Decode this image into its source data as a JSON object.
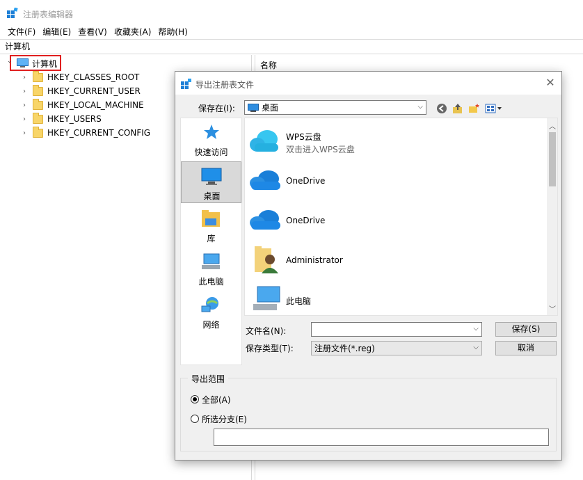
{
  "app": {
    "title": "注册表编辑器",
    "menu": [
      "文件(F)",
      "编辑(E)",
      "查看(V)",
      "收藏夹(A)",
      "帮助(H)"
    ],
    "address": "计算机"
  },
  "tree": {
    "root": "计算机",
    "nodes": [
      "HKEY_CLASSES_ROOT",
      "HKEY_CURRENT_USER",
      "HKEY_LOCAL_MACHINE",
      "HKEY_USERS",
      "HKEY_CURRENT_CONFIG"
    ]
  },
  "list": {
    "header": "名称"
  },
  "dialog": {
    "title": "导出注册表文件",
    "save_in_label": "保存在(I):",
    "save_in_value": "桌面",
    "places": [
      "快速访问",
      "桌面",
      "库",
      "此电脑",
      "网络"
    ],
    "files": [
      {
        "name": "WPS云盘",
        "sub": "双击进入WPS云盘"
      },
      {
        "name": "OneDrive",
        "sub": ""
      },
      {
        "name": "OneDrive",
        "sub": ""
      },
      {
        "name": "Administrator",
        "sub": ""
      },
      {
        "name": "此电脑",
        "sub": ""
      }
    ],
    "filename_label": "文件名(N):",
    "filename_value": "",
    "filetype_label": "保存类型(T):",
    "filetype_value": "注册文件(*.reg)",
    "save_button": "保存(S)",
    "cancel_button": "取消",
    "range_title": "导出范围",
    "range_all": "全部(A)",
    "range_branch": "所选分支(E)",
    "branch_value": ""
  },
  "colors": {
    "accent_highlight": "#e02020",
    "folder": "#f8d568",
    "onedrive": "#1e88e5"
  }
}
